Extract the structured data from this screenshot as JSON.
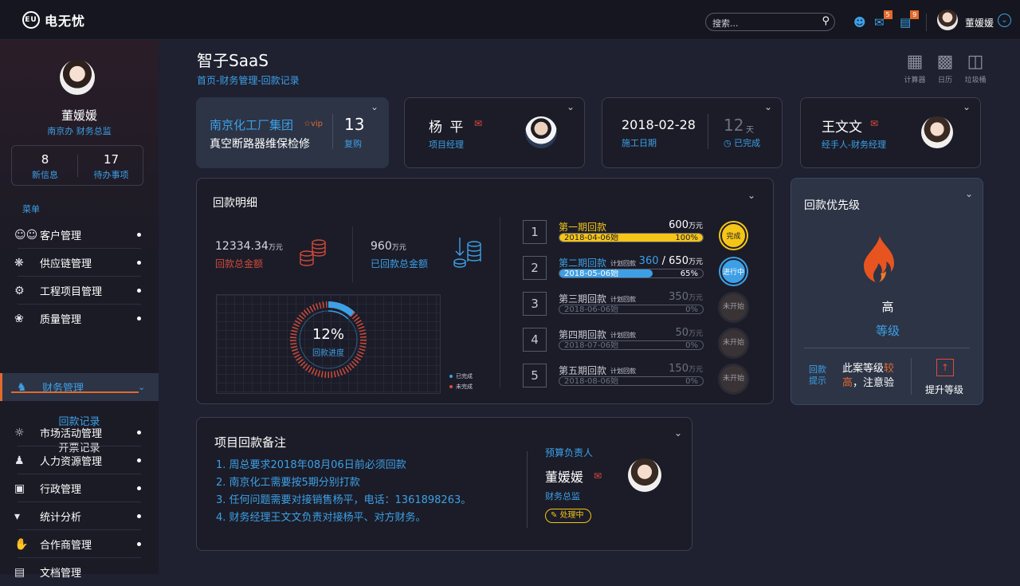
{
  "app": {
    "logo": "电无忧",
    "logo_mark": "EU"
  },
  "topbar": {
    "search_placeholder": "搜索...",
    "chat_badge": "5",
    "doc_badge": "9",
    "user_name": "董媛媛",
    "icons": {
      "search": "search-icon",
      "user": "user-icon",
      "chat": "chat-icon",
      "doc": "document-icon",
      "chevron": "chevron-down-icon"
    }
  },
  "sidebar": {
    "name": "董媛媛",
    "dept": "南京办  财务总监",
    "stats": [
      {
        "num": "8",
        "label": "新信息"
      },
      {
        "num": "17",
        "label": "待办事项"
      }
    ],
    "menu_title": "菜单",
    "items": [
      {
        "label": "客户管理",
        "icon": "users-icon"
      },
      {
        "label": "供应链管理",
        "icon": "network-icon"
      },
      {
        "label": "工程项目管理",
        "icon": "gear-icon"
      },
      {
        "label": "质量管理",
        "icon": "quality-icon"
      },
      {
        "label": "财务管理",
        "icon": "finance-icon"
      },
      {
        "label": "市场活动管理",
        "icon": "bulb-icon"
      },
      {
        "label": "人力资源管理",
        "icon": "person-icon"
      },
      {
        "label": "行政管理",
        "icon": "briefcase-icon"
      },
      {
        "label": "统计分析",
        "icon": "chart-icon"
      },
      {
        "label": "合作商管理",
        "icon": "handshake-icon"
      },
      {
        "label": "文档管理",
        "icon": "folder-icon"
      }
    ],
    "sub_items": [
      {
        "label": "回款记录"
      },
      {
        "label": "开票记录"
      }
    ]
  },
  "header": {
    "title": "智子SaaS",
    "breadcrumb": "首页-财务管理-回款记录"
  },
  "tools": [
    {
      "label": "计算器",
      "icon": "calculator-icon"
    },
    {
      "label": "日历",
      "icon": "calendar-icon"
    },
    {
      "label": "垃圾桶",
      "icon": "trash-icon"
    }
  ],
  "company_card": {
    "name": "南京化工厂集团",
    "vip": "☆vip",
    "project": "真空断路器维保检修",
    "count": "13",
    "count_label": "复购"
  },
  "pm_card": {
    "name": "杨  平",
    "role": "项目经理"
  },
  "date_card": {
    "date": "2018-02-28",
    "date_label": "施工日期",
    "days": "12",
    "days_unit": "天",
    "done_label": "已完成"
  },
  "handler_card": {
    "name": "王文文",
    "role": "经手人-财务经理"
  },
  "detail": {
    "title": "回款明细",
    "total_amount": "12334.34",
    "total_unit": "万元",
    "total_label": "回款总金额",
    "received_amount": "960",
    "received_unit": "万元",
    "received_label": "已回款总金额",
    "progress_pct": "12%",
    "progress_value": 12,
    "progress_label": "回款进度",
    "legend": [
      {
        "label": "已完成",
        "color": "#3da0e6"
      },
      {
        "label": "未完成",
        "color": "#e24a3b"
      }
    ],
    "phases": [
      {
        "num": "1",
        "name": "第一期回款",
        "plan": "",
        "amount": "600",
        "amount_done": "",
        "unit": "万元",
        "date": "2018-04-06始",
        "pct": "100%",
        "fill": 100,
        "status": "完成",
        "state": "done"
      },
      {
        "num": "2",
        "name": "第二期回款",
        "plan": "计划回款",
        "amount": "650",
        "amount_done": "360",
        "unit": "万元",
        "date": "2018-05-06始",
        "pct": "65%",
        "fill": 65,
        "status": "进行中",
        "state": "doing"
      },
      {
        "num": "3",
        "name": "第三期回款",
        "plan": "计划回款",
        "amount": "350",
        "amount_done": "",
        "unit": "万元",
        "date": "2018-06-06始",
        "pct": "0%",
        "fill": 0,
        "status": "未开始",
        "state": "todo"
      },
      {
        "num": "4",
        "name": "第四期回款",
        "plan": "计划回款",
        "amount": "50",
        "amount_done": "",
        "unit": "万元",
        "date": "2018-07-06始",
        "pct": "0%",
        "fill": 0,
        "status": "未开始",
        "state": "todo"
      },
      {
        "num": "5",
        "name": "第五期回款",
        "plan": "计划回款",
        "amount": "150",
        "amount_done": "",
        "unit": "万元",
        "date": "2018-08-06始",
        "pct": "0%",
        "fill": 0,
        "status": "未开始",
        "state": "todo"
      }
    ]
  },
  "priority": {
    "title": "回款优先级",
    "level": "高",
    "level_label": "等级",
    "tip": "回款提示",
    "msg_pre": "此案等级",
    "msg_hl": "较高",
    "msg_post": "，注意验",
    "upgrade_label": "提升等级",
    "upgrade_icon": "↑"
  },
  "notes": {
    "title": "项目回款备注",
    "items": [
      "1. 周总要求2018年08月06日前必须回款",
      "2. 南京化工需要按5期分别打款",
      "3. 任何问题需要对接销售杨平，电话：1361898263。",
      "4. 财务经理王文文负责对接杨平、对方财务。"
    ],
    "owner_role": "预算负责人",
    "owner_name": "董媛媛",
    "owner_title": "财务总监",
    "status": "处理中"
  },
  "colors": {
    "accent": "#3da0e6",
    "warn": "#e26a2c",
    "danger": "#e24a3b",
    "done": "#f5c518"
  }
}
